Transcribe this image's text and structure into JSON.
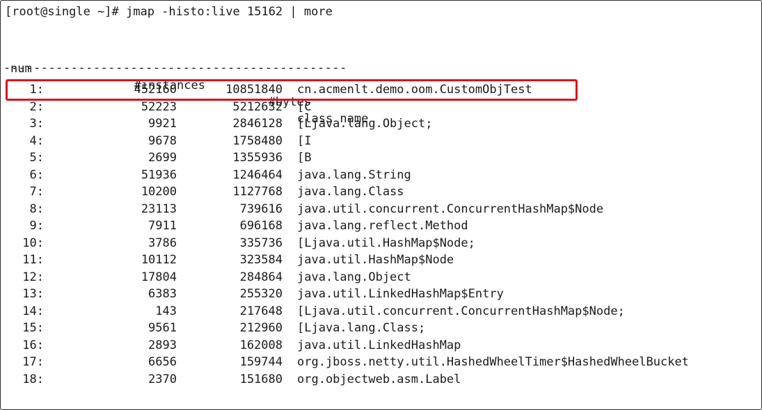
{
  "terminal": {
    "prompt": "[root@single ~]# jmap -histo:live 15162 | more",
    "headers": {
      "num": "num",
      "instances": "#instances",
      "bytes": "#bytes",
      "class_name": "class name"
    },
    "separator": "----------------------------------------------",
    "highlight_color": "#d9141c",
    "rows": [
      {
        "num": "1:",
        "instances": "452160",
        "bytes": "10851840",
        "class_name": "cn.acmenlt.demo.oom.CustomObjTest"
      },
      {
        "num": "2:",
        "instances": "52223",
        "bytes": "5212632",
        "class_name": "[C"
      },
      {
        "num": "3:",
        "instances": "9921",
        "bytes": "2846128",
        "class_name": "[Ljava.lang.Object;"
      },
      {
        "num": "4:",
        "instances": "9678",
        "bytes": "1758480",
        "class_name": "[I"
      },
      {
        "num": "5:",
        "instances": "2699",
        "bytes": "1355936",
        "class_name": "[B"
      },
      {
        "num": "6:",
        "instances": "51936",
        "bytes": "1246464",
        "class_name": "java.lang.String"
      },
      {
        "num": "7:",
        "instances": "10200",
        "bytes": "1127768",
        "class_name": "java.lang.Class"
      },
      {
        "num": "8:",
        "instances": "23113",
        "bytes": "739616",
        "class_name": "java.util.concurrent.ConcurrentHashMap$Node"
      },
      {
        "num": "9:",
        "instances": "7911",
        "bytes": "696168",
        "class_name": "java.lang.reflect.Method"
      },
      {
        "num": "10:",
        "instances": "3786",
        "bytes": "335736",
        "class_name": "[Ljava.util.HashMap$Node;"
      },
      {
        "num": "11:",
        "instances": "10112",
        "bytes": "323584",
        "class_name": "java.util.HashMap$Node"
      },
      {
        "num": "12:",
        "instances": "17804",
        "bytes": "284864",
        "class_name": "java.lang.Object"
      },
      {
        "num": "13:",
        "instances": "6383",
        "bytes": "255320",
        "class_name": "java.util.LinkedHashMap$Entry"
      },
      {
        "num": "14:",
        "instances": "143",
        "bytes": "217648",
        "class_name": "[Ljava.util.concurrent.ConcurrentHashMap$Node;"
      },
      {
        "num": "15:",
        "instances": "9561",
        "bytes": "212960",
        "class_name": "[Ljava.lang.Class;"
      },
      {
        "num": "16:",
        "instances": "2893",
        "bytes": "162008",
        "class_name": "java.util.LinkedHashMap"
      },
      {
        "num": "17:",
        "instances": "6656",
        "bytes": "159744",
        "class_name": "org.jboss.netty.util.HashedWheelTimer$HashedWheelBucket"
      },
      {
        "num": "18:",
        "instances": "2370",
        "bytes": "151680",
        "class_name": "org.objectweb.asm.Label"
      }
    ]
  }
}
